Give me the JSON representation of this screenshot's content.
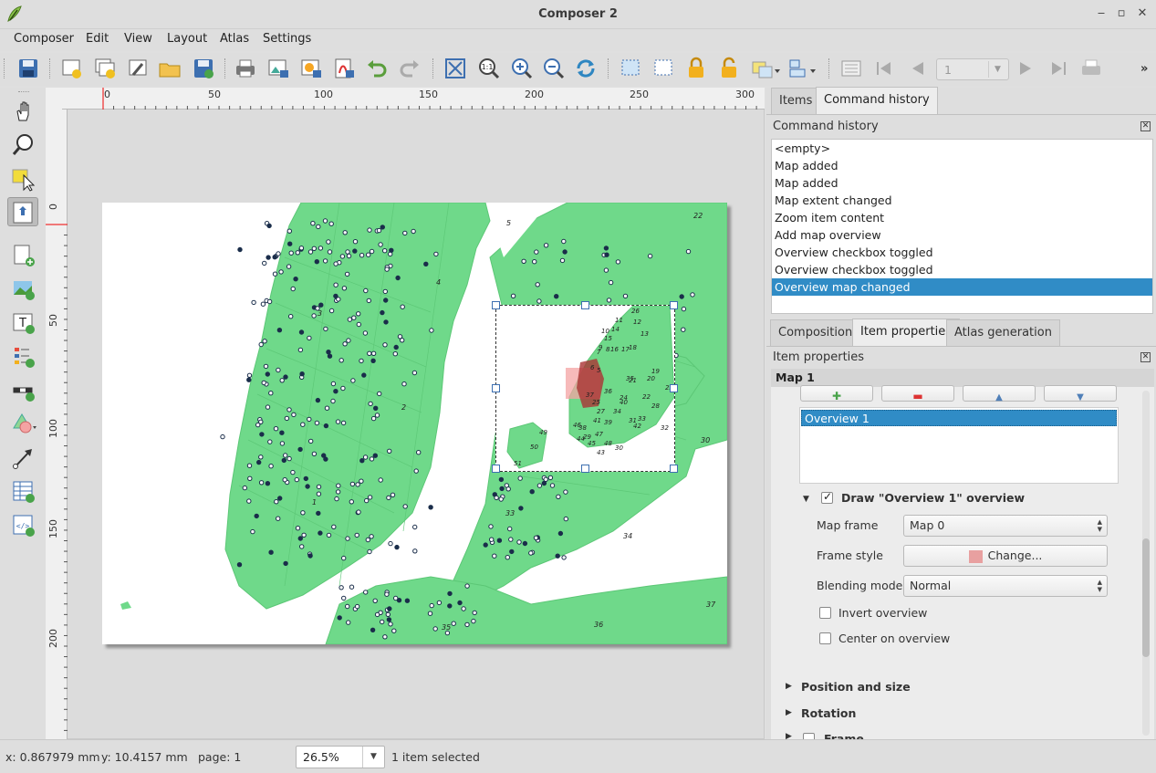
{
  "window": {
    "title": "Composer 2"
  },
  "menu": [
    "Composer",
    "Edit",
    "View",
    "Layout",
    "Atlas",
    "Settings"
  ],
  "toolbar": {
    "icons": [
      "save-icon",
      "new-composer-icon",
      "duplicate-composer-icon",
      "composer-manager-icon",
      "open-template-icon",
      "save-template-icon",
      "print-icon",
      "export-image-icon",
      "export-svg-icon",
      "export-pdf-icon",
      "undo-icon",
      "redo-icon",
      "zoom-full-icon",
      "zoom-actual-icon",
      "zoom-in-icon",
      "zoom-out-icon",
      "refresh-icon",
      "select-all-icon",
      "deselect-icon",
      "lock-icon",
      "unlock-icon",
      "group-icon",
      "align-icon",
      "atlas-preview-icon",
      "first-feature-icon",
      "prev-feature-icon",
      "next-feature-icon",
      "last-feature-icon",
      "atlas-print-icon"
    ],
    "atlas_page": "1"
  },
  "left_tools": [
    "pan-icon",
    "zoom-tool-icon",
    "select-move-icon",
    "move-content-icon",
    "add-map-icon",
    "add-image-icon",
    "add-label-icon",
    "add-legend-icon",
    "add-scalebar-icon",
    "add-shape-icon",
    "add-arrow-icon",
    "add-table-icon",
    "add-html-icon"
  ],
  "ruler": {
    "h_labels": [
      "0",
      "50",
      "100",
      "150",
      "200",
      "250",
      "300"
    ],
    "v_labels": [
      "0",
      "50",
      "100",
      "150",
      "200"
    ]
  },
  "map": {
    "labels": [
      "5",
      "22",
      "4",
      "3",
      "2",
      "1",
      "33",
      "34",
      "35",
      "37",
      "36",
      "30",
      "49",
      "50",
      "51"
    ],
    "overview_labels": [
      "26",
      "11",
      "12",
      "10",
      "14",
      "13",
      "15",
      "16",
      "17",
      "18",
      "19",
      "20",
      "23",
      "21",
      "22",
      "24",
      "25",
      "27",
      "28",
      "29",
      "30",
      "31",
      "32",
      "33",
      "34",
      "35",
      "36",
      "37",
      "38",
      "39",
      "40",
      "41",
      "42",
      "43",
      "44",
      "45",
      "46",
      "47",
      "48",
      "9",
      "8",
      "7",
      "6",
      "5"
    ]
  },
  "dock": {
    "tabs_top": [
      "Items",
      "Command history"
    ],
    "history_title": "Command history",
    "history": [
      "<empty>",
      "Map added",
      "Map added",
      "Map extent changed",
      "Zoom item content",
      "Add map overview",
      "Overview checkbox toggled",
      "Overview checkbox toggled",
      "Overview map changed"
    ],
    "history_selected_index": 8,
    "tabs_bottom": [
      "Composition",
      "Item properties",
      "Atlas generation"
    ],
    "props_title": "Item properties",
    "item_name": "Map 1",
    "overview_list": [
      "Overview 1"
    ],
    "draw_overview_label": "Draw \"Overview 1\" overview",
    "draw_overview_checked": true,
    "map_frame_label": "Map frame",
    "map_frame_value": "Map 0",
    "frame_style_label": "Frame style",
    "frame_style_button": "Change...",
    "frame_style_color": "#e8a0a0",
    "blending_label": "Blending mode",
    "blending_value": "Normal",
    "invert_label": "Invert overview",
    "invert_checked": false,
    "center_label": "Center on overview",
    "center_checked": false,
    "sections": [
      "Position and size",
      "Rotation",
      "Frame"
    ]
  },
  "status": {
    "x": "x: 0.867979 mm",
    "y": "y: 10.4157 mm",
    "page": "page: 1",
    "zoom": "26.5%",
    "selection": "1 item selected"
  },
  "colors": {
    "map_land": "#6fd98a",
    "map_border": "#5cc776",
    "selection": "#308cc6",
    "overview_fill": "#f4a3a3"
  }
}
